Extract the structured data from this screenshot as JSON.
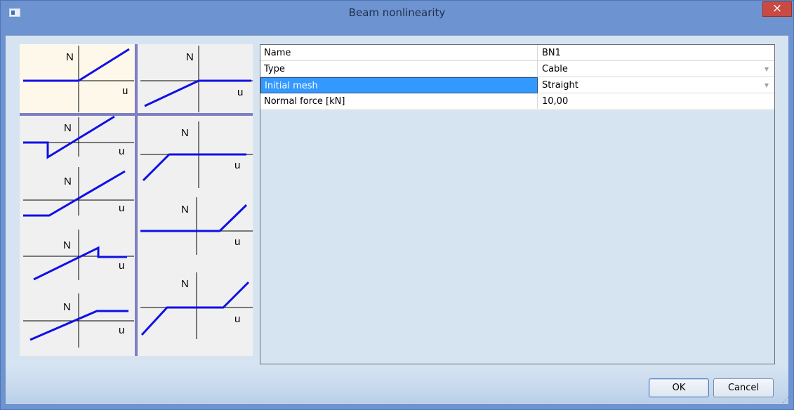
{
  "window": {
    "title": "Beam nonlinearity",
    "close_glyph": "×"
  },
  "gallery": {
    "axis_force_label": "N",
    "axis_disp_label": "u"
  },
  "properties": [
    {
      "name": "Name",
      "value": "BN1",
      "dropdown": false
    },
    {
      "name": "Type",
      "value": "Cable",
      "dropdown": true
    },
    {
      "name": "Initial mesh",
      "value": "Straight",
      "dropdown": true,
      "selected": true
    },
    {
      "name": "Normal force [kN]",
      "value": "10,00",
      "dropdown": false
    }
  ],
  "buttons": {
    "ok": "OK",
    "cancel": "Cancel"
  },
  "colors": {
    "curve": "#1010e6",
    "selection": "#3399ff",
    "divider": "#7f7fc4"
  },
  "icons": {
    "dropdown": "chevron-down-icon",
    "close": "close-icon",
    "grip": "resize-grip-icon"
  }
}
